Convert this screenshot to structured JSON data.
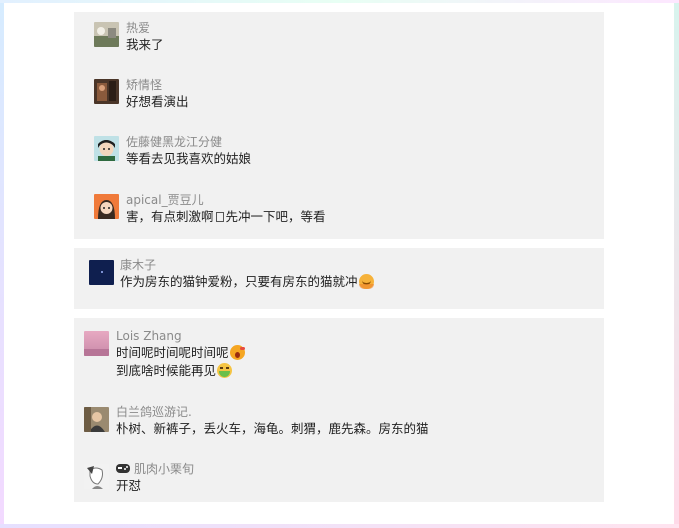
{
  "comments_group_1": [
    {
      "name": "热爱",
      "avatar_icon": "landscape-photo-avatar",
      "lines": [
        "我来了"
      ]
    },
    {
      "name": "矫情怪",
      "avatar_icon": "dark-photo-avatar",
      "lines": [
        "好想看演出"
      ]
    },
    {
      "name": "佐藤健黑龙江分健",
      "avatar_icon": "anime-boy-avatar",
      "lines": [
        "等看去见我喜欢的姑娘"
      ]
    },
    {
      "name": "apical_贾豆儿",
      "avatar_icon": "cartoon-girl-orange-avatar",
      "line_before_box": "害，有点刺激啊",
      "line_after_box": "先冲一下吧，等看"
    }
  ],
  "comments_group_2": [
    {
      "name": "康木子",
      "avatar_icon": "dark-blue-avatar",
      "lines": [
        "作为房东的猫钟爱粉，只要有房东的猫就冲"
      ],
      "emoji": "hugging-face-emoji"
    }
  ],
  "comments_group_3": [
    {
      "name": "Lois Zhang",
      "avatar_icon": "pink-sky-avatar",
      "lines": [
        "时间呢时间呢时间呢",
        "到底啥时候能再见"
      ],
      "emojis": [
        "astonished-face-emoji",
        "nauseated-face-emoji"
      ]
    },
    {
      "name": "白兰鸽巡游记.",
      "avatar_icon": "person-photo-avatar",
      "lines": [
        "朴树、新裤子，丢火车，海龟。刺猬，鹿先森。房东的猫"
      ]
    },
    {
      "name": "肌肉小栗旬",
      "name_prefix_icon": "game-controller-icon",
      "avatar_icon": "sketch-portrait-avatar",
      "lines": [
        "开怼"
      ]
    }
  ],
  "colors": {
    "card_bg": "#f1f1f1",
    "name": "#8a8a8a",
    "text": "#222222",
    "page_bg": "#ffffff"
  }
}
